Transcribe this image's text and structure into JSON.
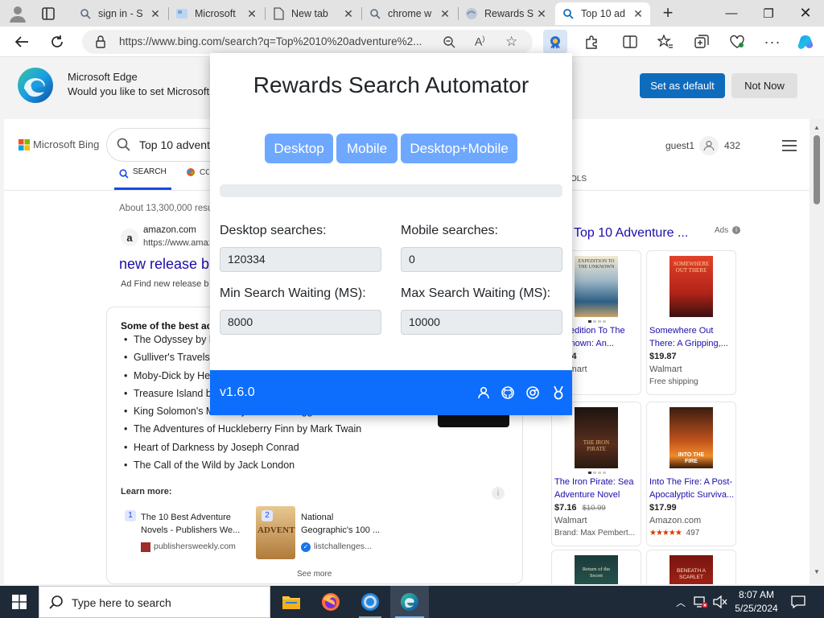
{
  "browser": {
    "tabs": [
      {
        "title": "sign in - S",
        "icon": "search-icon"
      },
      {
        "title": "Microsoft",
        "icon": "microsoft-page-icon"
      },
      {
        "title": "New tab",
        "icon": "page-icon"
      },
      {
        "title": "chrome w",
        "icon": "search-icon"
      },
      {
        "title": "Rewards S",
        "icon": "edge-icon"
      },
      {
        "title": "Top 10 ad",
        "icon": "search-icon"
      }
    ],
    "new_tab_label": "+",
    "url": "https://www.bing.com/search?q=Top%2010%20adventure%2..."
  },
  "banner": {
    "title": "Microsoft Edge",
    "text": "Would you like to set Microsoft Edge as your default browser?",
    "set_default": "Set as default",
    "not_now": "Not Now"
  },
  "bing": {
    "logo_text": "Microsoft Bing",
    "query": "Top 10 adventure books",
    "tabs": [
      "SEARCH",
      "COPILOT",
      "TOOLS"
    ],
    "user": "guest1",
    "points": "432",
    "result_count": "About 13,300,000 results",
    "ad_site": "amazon.com",
    "ad_url": "https://www.amazon.com",
    "ad_title": "new release books",
    "ad_desc": "Ad  Find new release books",
    "answer_heading": "Some of the best adventure books",
    "list": [
      "The Odyssey by Homer",
      "Gulliver's Travels by Jonathan Swift",
      "Moby-Dick by Herman Melville",
      "Treasure Island by Robert Louis Stevenson",
      "King Solomon's Mines by H. Rider Haggard",
      "The Adventures of Huckleberry Finn by Mark Twain",
      "Heart of Darkness by Joseph Conrad",
      "The Call of the Wild by Jack London"
    ],
    "learn_more": "Learn more:",
    "sources": [
      {
        "num": "1",
        "title": "The 10 Best Adventure Novels - Publishers We...",
        "site": "publishersweekly.com"
      },
      {
        "num": "2",
        "title": "National Geographic's 100 ...",
        "site": "listchallenges..."
      }
    ],
    "see_more": "See more"
  },
  "ads": {
    "header": "Top 10 Adventure ...",
    "ads_label": "Ads",
    "cards": [
      {
        "title1": "Expedition To The",
        "title2": "Unknown: An...",
        "price": "$...94",
        "seller": "Walmart",
        "extra": "",
        "cover_text": "EXPEDITION TO THE UNKNOWN"
      },
      {
        "title1": "Somewhere Out",
        "title2": "There: A Gripping,...",
        "price": "$19.87",
        "seller": "Walmart",
        "extra": "Free shipping",
        "cover_text": "SOMEWHERE OUT THERE"
      },
      {
        "title1": "The Iron Pirate: Sea",
        "title2": "Adventure Novel",
        "price": "$7.16",
        "old_price": "$10.99",
        "seller": "Walmart",
        "extra": "Brand: Max Pembert...",
        "cover_text": "THE IRON PIRATE",
        "badge": "off"
      },
      {
        "title1": "Into The Fire: A Post-",
        "title2": "Apocalyptic Surviva...",
        "price": "$17.99",
        "seller": "Amazon.com",
        "extra": "497",
        "cover_text": "INTO THE FIRE"
      }
    ],
    "cover5": "Return of the Secret",
    "cover6": "BENEATH A SCARLET"
  },
  "popup": {
    "title": "Rewards Search Automator",
    "buttons": [
      "Desktop",
      "Mobile",
      "Desktop+Mobile"
    ],
    "desktop_label": "Desktop searches:",
    "mobile_label": "Mobile searches:",
    "desktop_value": "120334",
    "mobile_value": "0",
    "min_label": "Min Search Waiting (MS):",
    "max_label": "Max Search Waiting (MS):",
    "min_value": "8000",
    "max_value": "10000",
    "version": "v1.6.0",
    "progress": 0
  },
  "taskbar": {
    "search_placeholder": "Type here to search",
    "time": "8:07 AM",
    "date": "5/25/2024"
  },
  "colors": {
    "popup_blue": "#0d6efd",
    "button_blue": "#6ea8fe",
    "banner_button": "#0f6cbd"
  }
}
